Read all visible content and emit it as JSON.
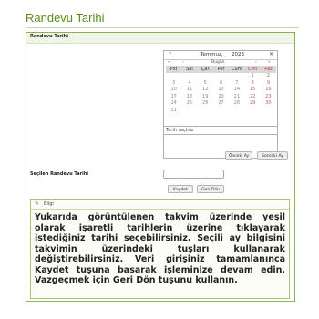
{
  "page": {
    "title": "Randevu Tarihi"
  },
  "panel": {
    "header": "Randevu Tarihi"
  },
  "calendar": {
    "help": "?",
    "month": "Temmuz,",
    "year": "2023",
    "close": "×",
    "nav": [
      "«",
      "‹",
      "Bugün",
      "›",
      "»"
    ],
    "weekdays": [
      "Pzt",
      "Sal",
      "Çar",
      "Per",
      "Cum",
      "Cmt",
      "Paz"
    ],
    "weeks": [
      [
        "",
        "",
        "",
        "",
        "",
        "1",
        "2"
      ],
      [
        "3",
        "4",
        "5",
        "6",
        "7",
        "8",
        "9"
      ],
      [
        "10",
        "11",
        "12",
        "13",
        "14",
        "15",
        "16"
      ],
      [
        "17",
        "18",
        "19",
        "20",
        "21",
        "22",
        "23"
      ],
      [
        "24",
        "25",
        "26",
        "27",
        "28",
        "29",
        "30"
      ],
      [
        "31",
        "",
        "",
        "",
        "",
        "",
        ""
      ]
    ],
    "status": "Tarih seçiniz"
  },
  "buttons": {
    "prev_month": "Önceki Ay",
    "next_month": "Sonraki Ay",
    "save": "Kaydet",
    "back": "Geri Dön"
  },
  "selected": {
    "label": "Seçilen Randevu Tarihi",
    "value": ""
  },
  "info": {
    "title": "Bilgi",
    "text": "Yukarıda görüntülenen takvim üzerinde yeşil olarak işaretli tarihlerin üzerine tıklayarak istediğiniz tarihi seçebilirsiniz. Seçili ay bilgisini takvimin üzerindeki tuşları kullanarak değiştirebilirsiniz. Veri girişiniz tamamlanınca Kaydet tuşuna basarak işleminize devam edin. Vazgeçmek için Geri Dön tuşunu kullanın."
  },
  "icons": {
    "info": "info-icon"
  }
}
